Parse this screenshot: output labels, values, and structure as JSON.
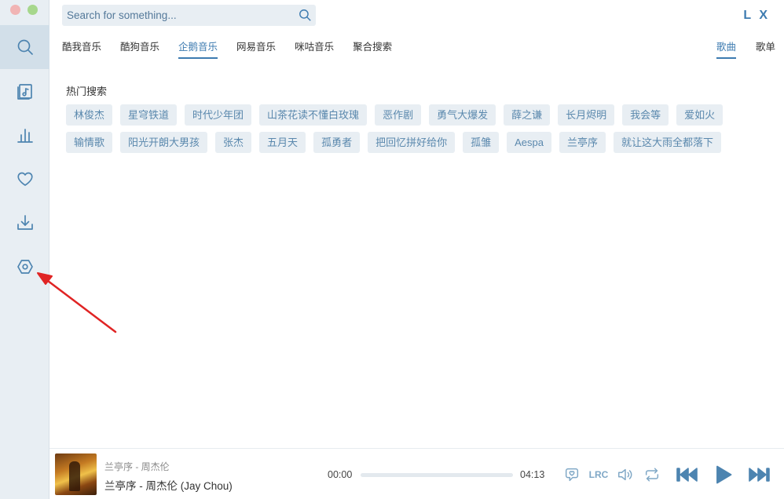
{
  "window": {
    "brand": "L X"
  },
  "search": {
    "placeholder": "Search for something..."
  },
  "nav": [
    {
      "icon": "search-icon",
      "active": true
    },
    {
      "icon": "music-list-icon",
      "active": false
    },
    {
      "icon": "leaderboard-icon",
      "active": false
    },
    {
      "icon": "heart-icon",
      "active": false
    },
    {
      "icon": "download-icon",
      "active": false
    },
    {
      "icon": "settings-icon",
      "active": false
    }
  ],
  "sources": [
    "酷我音乐",
    "酷狗音乐",
    "企鹅音乐",
    "网易音乐",
    "咪咕音乐",
    "聚合搜索"
  ],
  "active_source": "企鹅音乐",
  "types": [
    "歌曲",
    "歌单"
  ],
  "active_type": "歌曲",
  "hot": {
    "title": "热门搜索",
    "tags": [
      "林俊杰",
      "星穹铁道",
      "时代少年团",
      "山茶花读不懂白玫瑰",
      "恶作剧",
      "勇气大爆发",
      "薛之谦",
      "长月烬明",
      "我会等",
      "爱如火",
      "输情歌",
      "阳光开朗大男孩",
      "张杰",
      "五月天",
      "孤勇者",
      "把回忆拼好给你",
      "孤雏",
      "Aespa",
      "兰亭序",
      "就让这大雨全都落下"
    ]
  },
  "player": {
    "subtitle": "兰亭序 - 周杰伦",
    "title": "兰亭序 - 周杰伦 (Jay Chou)",
    "current_time": "00:00",
    "total_time": "04:13",
    "progress": 0,
    "lrc_label": "LRC"
  },
  "colors": {
    "accent": "#3d7bb0",
    "sidebar_bg": "#e8eef3",
    "tag_bg": "#e8eef3",
    "annotation_arrow": "#e02424"
  }
}
